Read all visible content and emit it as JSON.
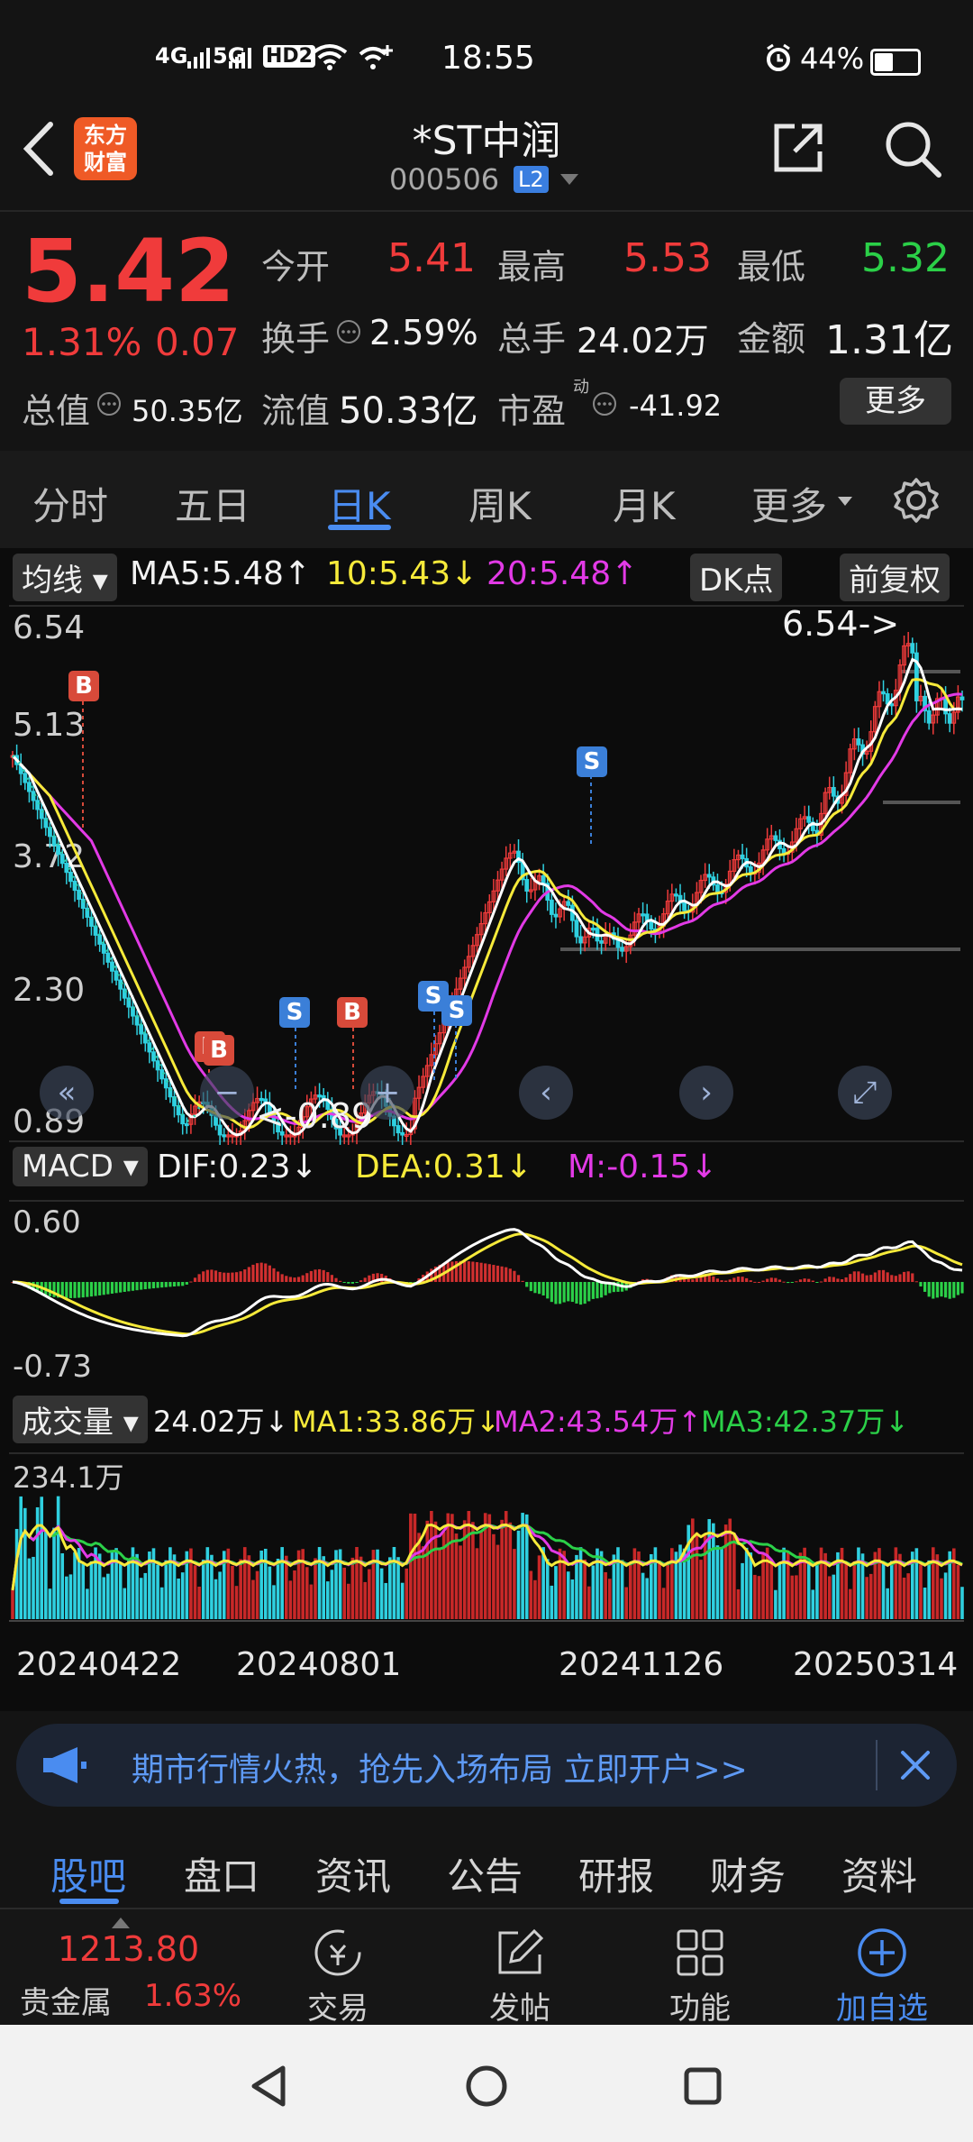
{
  "status_bar": {
    "network_labels": [
      "4G",
      "5G",
      "HD2"
    ],
    "time": "18:55",
    "battery": "44%",
    "battery_level": 0.44
  },
  "header": {
    "app_logo_line1": "东方",
    "app_logo_line2": "财富",
    "title": "*ST中润",
    "code": "000506",
    "level_badge": "L2"
  },
  "quote": {
    "price": "5.42",
    "change_pct": "1.31%",
    "change": "0.07",
    "open_label": "今开",
    "open": "5.41",
    "high_label": "最高",
    "high": "5.53",
    "low_label": "最低",
    "low": "5.32",
    "turnover_label": "换手",
    "turnover": "2.59%",
    "volume_label": "总手",
    "volume": "24.02万",
    "amount_label": "金额",
    "amount": "1.31亿",
    "mcap_label": "总值",
    "mcap": "50.35亿",
    "float_label": "流值",
    "float_mcap": "50.33亿",
    "pe_label": "市盈",
    "pe_sup": "动",
    "pe": "-41.92",
    "more_button": "更多"
  },
  "tabs": [
    "分时",
    "五日",
    "日K",
    "周K",
    "月K",
    "更多"
  ],
  "active_tab": "日K",
  "chart": {
    "ma_selector": "均线",
    "ma5": "MA5:5.48",
    "ma10": "10:5.43",
    "ma20": "20:5.48",
    "dk_button": "DK点",
    "adjust_button": "前复权",
    "price_axis": [
      "6.54",
      "5.13",
      "3.72",
      "2.30",
      "0.89"
    ],
    "max_marker": "6.54->",
    "min_marker": "<-0.89",
    "macd_selector": "MACD",
    "dif": "DIF:0.23",
    "dea": "DEA:0.31",
    "m": "M:-0.15",
    "macd_axis": [
      "0.60",
      "-0.73"
    ],
    "vol_selector": "成交量",
    "vol_value": "24.02万",
    "vol_ma1": "MA1:33.86万",
    "vol_ma2": "MA2:43.54万",
    "vol_ma3": "MA3:42.37万",
    "vol_axis_max": "234.1万",
    "dates": [
      "20240422",
      "20240801",
      "20241126",
      "20250314"
    ],
    "markers": [
      "B",
      "B",
      "B",
      "S",
      "B",
      "S",
      "S",
      "S"
    ]
  },
  "promo": {
    "text": "期市行情火热，抢先入场布局 立即开户>>"
  },
  "bottom_tabs": [
    "股吧",
    "盘口",
    "资讯",
    "公告",
    "研报",
    "财务",
    "资料"
  ],
  "active_bottom_tab": "股吧",
  "toolbar": {
    "metal_value": "1213.80",
    "metal_label": "贵金属",
    "metal_pct": "1.63%",
    "trade": "交易",
    "post": "发帖",
    "functions": "功能",
    "add_watch": "加自选"
  },
  "colors": {
    "up": "#f03b3b",
    "down": "#2bd048",
    "accent": "#4a8cf0",
    "ma5": "#ffffff",
    "ma10": "#f6ea3a",
    "ma20": "#e23ae6"
  }
}
